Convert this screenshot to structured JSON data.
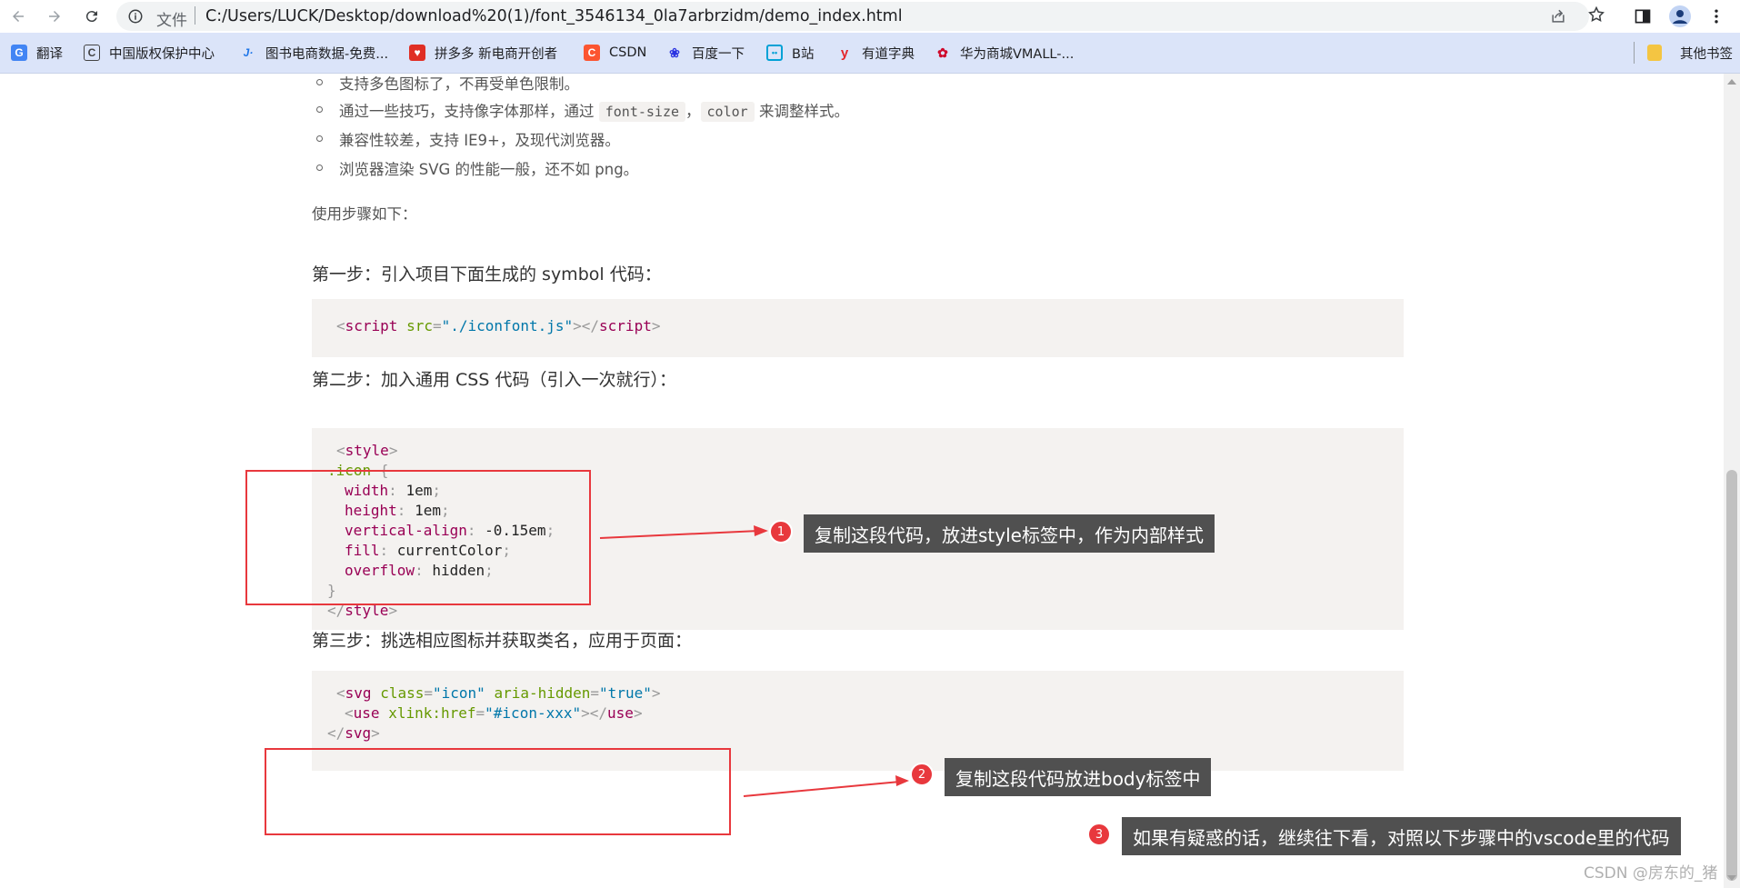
{
  "browser": {
    "url_scheme": "文件",
    "url": "C:/Users/LUCK/Desktop/download%20(1)/font_3546134_0la7arbrzidm/demo_index.html",
    "bookmarks": [
      {
        "label": "翻译",
        "icon": "translate-icon",
        "color": "#4285f4"
      },
      {
        "label": "中国版权保护中心",
        "icon": "copyright-center-icon",
        "color": "#444"
      },
      {
        "label": "图书电商数据-免费...",
        "icon": "book-data-icon",
        "color": "#1a73e8"
      },
      {
        "label": "拼多多 新电商开创者",
        "icon": "pinduoduo-icon",
        "color": "#e02e24"
      },
      {
        "label": "CSDN",
        "icon": "csdn-icon",
        "color": "#fc5531"
      },
      {
        "label": "百度一下",
        "icon": "baidu-icon",
        "color": "#2932e1"
      },
      {
        "label": "B站",
        "icon": "bilibili-icon",
        "color": "#00a1d6"
      },
      {
        "label": "有道字典",
        "icon": "youdao-icon",
        "color": "#e4262c"
      },
      {
        "label": "华为商城VMALL-...",
        "icon": "huawei-icon",
        "color": "#cf0a2c"
      }
    ],
    "other_bookmarks": "其他书签"
  },
  "content": {
    "bullets": [
      {
        "text": "支持多色图标了，不再受单色限制。"
      },
      {
        "pre": "通过一些技巧，支持像字体那样，通过",
        "code1": "font-size",
        "mid": "，",
        "code2": "color",
        "post": "来调整样式。"
      },
      {
        "text": "兼容性较差，支持 IE9+，及现代浏览器。"
      },
      {
        "text": "浏览器渲染 SVG 的性能一般，还不如 png。"
      }
    ],
    "usage_intro": "使用步骤如下：",
    "step1": "第一步：引入项目下面生成的 symbol 代码：",
    "step2": "第二步：加入通用 CSS 代码（引入一次就行）：",
    "step3": "第三步：挑选相应图标并获取类名，应用于页面："
  },
  "code": {
    "script_tag": {
      "open_lt": "<",
      "tag": "script",
      "attr": "src",
      "eq": "=",
      "value": "\"./iconfont.js\"",
      "close": "></",
      "tag2": "script",
      "gt": ">"
    },
    "css_lines": [
      {
        "kind": "tag",
        "text_a": "<",
        "text_b": "style",
        "text_c": ">"
      },
      {
        "kind": "selector",
        "sel": ".icon",
        "brace": " {"
      },
      {
        "kind": "decl",
        "prop": "width",
        "val": "1em"
      },
      {
        "kind": "decl",
        "prop": "height",
        "val": "1em"
      },
      {
        "kind": "decl",
        "prop": "vertical-align",
        "val": "-0.15em"
      },
      {
        "kind": "decl",
        "prop": "fill",
        "val": "currentColor"
      },
      {
        "kind": "decl",
        "prop": "overflow",
        "val": "hidden"
      },
      {
        "kind": "brace",
        "text": "}"
      },
      {
        "kind": "tag",
        "text_a": "</",
        "text_b": "style",
        "text_c": ">"
      }
    ],
    "svg_lines": {
      "l1": {
        "lt": "<",
        "tag": "svg",
        "a1": "class",
        "v1": "\"icon\"",
        "a2": "aria-hidden",
        "v2": "\"true\"",
        "gt": ">"
      },
      "l2": {
        "lt": "<",
        "tag": "use",
        "a1": "xlink:href",
        "v1": "\"#icon-xxx\"",
        "close": "></",
        "tag2": "use",
        "gt": ">"
      },
      "l3": {
        "lt": "</",
        "tag": "svg",
        "gt": ">"
      }
    }
  },
  "annotations": [
    {
      "number": "1",
      "text": "复制这段代码，放进style标签中，作为内部样式"
    },
    {
      "number": "2",
      "text": "复制这段代码放进body标签中"
    },
    {
      "number": "3",
      "text": "如果有疑惑的话，继续往下看，对照以下步骤中的vscode里的代码"
    }
  ],
  "watermark": "CSDN @房东的_猪",
  "colors": {
    "annotation_red": "#e8383d",
    "tooltip_bg": "#505050",
    "code_bg": "#f4f2f0"
  }
}
